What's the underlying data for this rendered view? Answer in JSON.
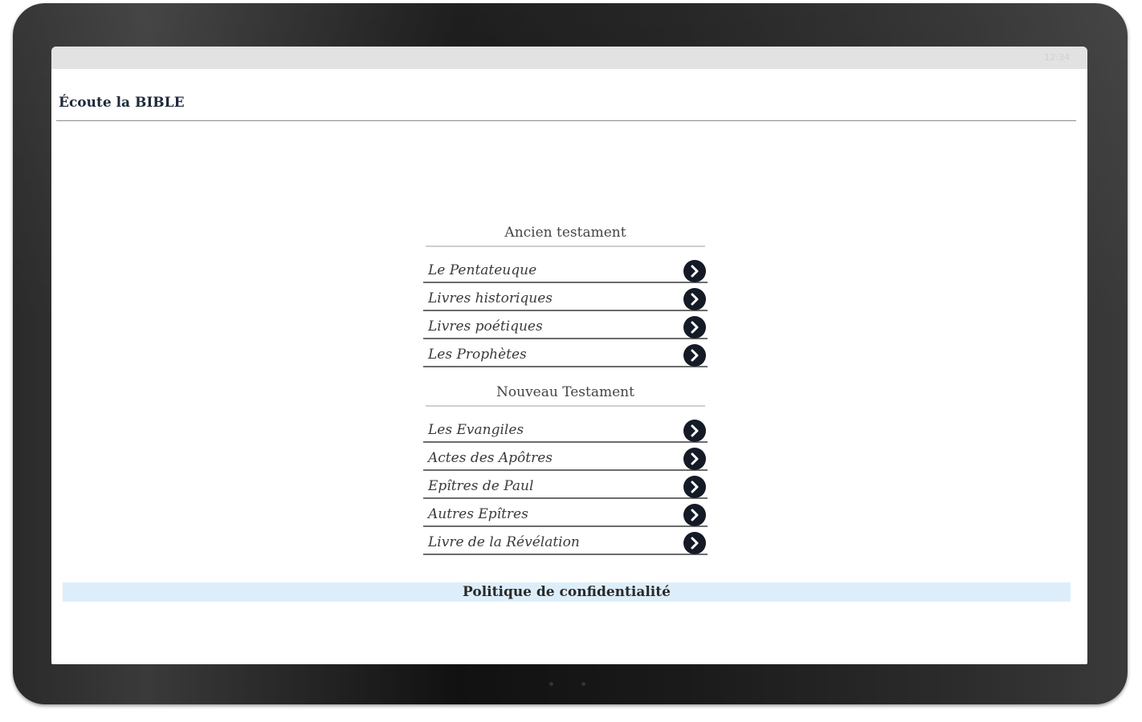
{
  "status_bar": {
    "time": "12:34"
  },
  "header": {
    "title": "Écoute la BIBLE"
  },
  "old_testament": {
    "title": "Ancien testament",
    "items": [
      {
        "label": "Le Pentateuque"
      },
      {
        "label": "Livres historiques"
      },
      {
        "label": "Livres poétiques"
      },
      {
        "label": "Les Prophètes"
      }
    ]
  },
  "new_testament": {
    "title": "Nouveau Testament",
    "items": [
      {
        "label": "Les Evangiles"
      },
      {
        "label": "Actes des Apôtres"
      },
      {
        "label": "Epîtres de Paul"
      },
      {
        "label": "Autres Epîtres"
      },
      {
        "label": "Livre de la Révélation"
      }
    ]
  },
  "footer": {
    "privacy_label": "Politique de confidentialité"
  },
  "colors": {
    "arrow_circle": "#141b26",
    "privacy_bg": "#ddeefa",
    "status_bar_bg": "#e2e2e2"
  },
  "icons": {
    "menu_arrow": "chevron-right-icon"
  }
}
